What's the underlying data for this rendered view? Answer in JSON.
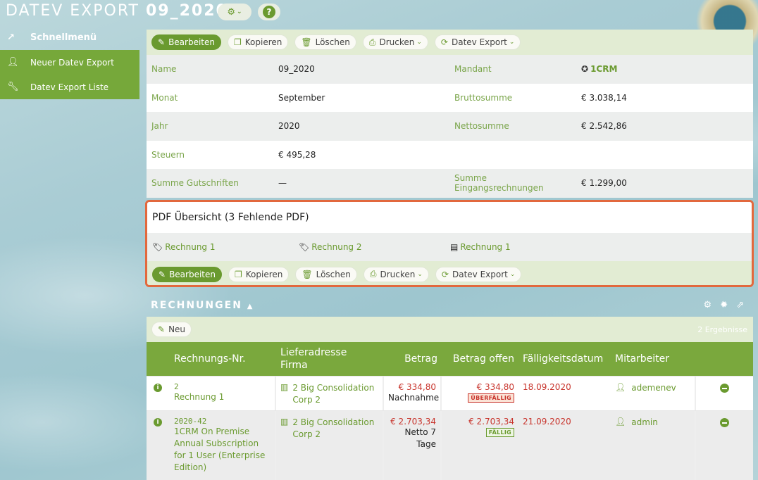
{
  "header": {
    "title_prefix": "DATEV EXPORT",
    "title_record": "09_2020",
    "settings_icon": "gear-icon",
    "help_label": "?"
  },
  "sidebar": {
    "items": [
      {
        "label": "Schnellmenü",
        "icon": "trend-icon"
      },
      {
        "label": "Neuer Datev Export",
        "icon": "user-icon"
      },
      {
        "label": "Datev Export Liste",
        "icon": "wrench-icon"
      }
    ]
  },
  "toolbar": {
    "edit": "Bearbeiten",
    "copy": "Kopieren",
    "delete": "Löschen",
    "print": "Drucken",
    "export": "Datev Export"
  },
  "details": {
    "name_label": "Name",
    "name_value": "09_2020",
    "mandant_label": "Mandant",
    "mandant_value": "1CRM",
    "monat_label": "Monat",
    "monat_value": "September",
    "brutto_label": "Bruttosumme",
    "brutto_value": "€ 3.038,14",
    "jahr_label": "Jahr",
    "jahr_value": "2020",
    "netto_label": "Nettosumme",
    "netto_value": "€ 2.542,86",
    "steuern_label": "Steuern",
    "steuern_value": "€ 495,28",
    "gutschriften_label": "Summe Gutschriften",
    "gutschriften_value": "—",
    "eingang_label": "Summe Eingangsrechnungen",
    "eingang_value": "€ 1.299,00"
  },
  "pdf": {
    "title": "PDF Übersicht (3 Fehlende PDF)",
    "links": [
      "Rechnung 1",
      "Rechnung 2",
      "Rechnung 1"
    ]
  },
  "rechnungen": {
    "title": "RECHNUNGEN",
    "new_label": "Neu",
    "count": "2 Ergebnisse",
    "columns": {
      "nr": "Rechnungs-Nr.",
      "address_line1": "Lieferadresse",
      "address_line2": "Firma",
      "betrag": "Betrag",
      "offen": "Betrag offen",
      "date": "Fälligkeitsdatum",
      "user": "Mitarbeiter"
    },
    "rows": [
      {
        "code": "2",
        "name": "Rechnung 1",
        "address": "2 Big Consolidation Corp 2",
        "betrag": "€ 334,80",
        "betrag_note": "Nachnahme",
        "offen": "€ 334,80",
        "status": "ÜBERFÄLLIG",
        "date": "18.09.2020",
        "user": "ademenev"
      },
      {
        "code": "2020-42",
        "name": "1CRM On Premise Annual Subscription for 1 User (Enterprise Edition)",
        "address": "2 Big Consolidation Corp 2",
        "betrag": "€ 2.703,34",
        "betrag_note": "Netto 7 Tage",
        "offen": "€ 2.703,34",
        "status": "FÄLLIG",
        "date": "21.09.2020",
        "user": "admin"
      }
    ]
  },
  "colors": {
    "accent": "#76a83a",
    "highlight_border": "#e2683d",
    "danger": "#c8342c"
  }
}
